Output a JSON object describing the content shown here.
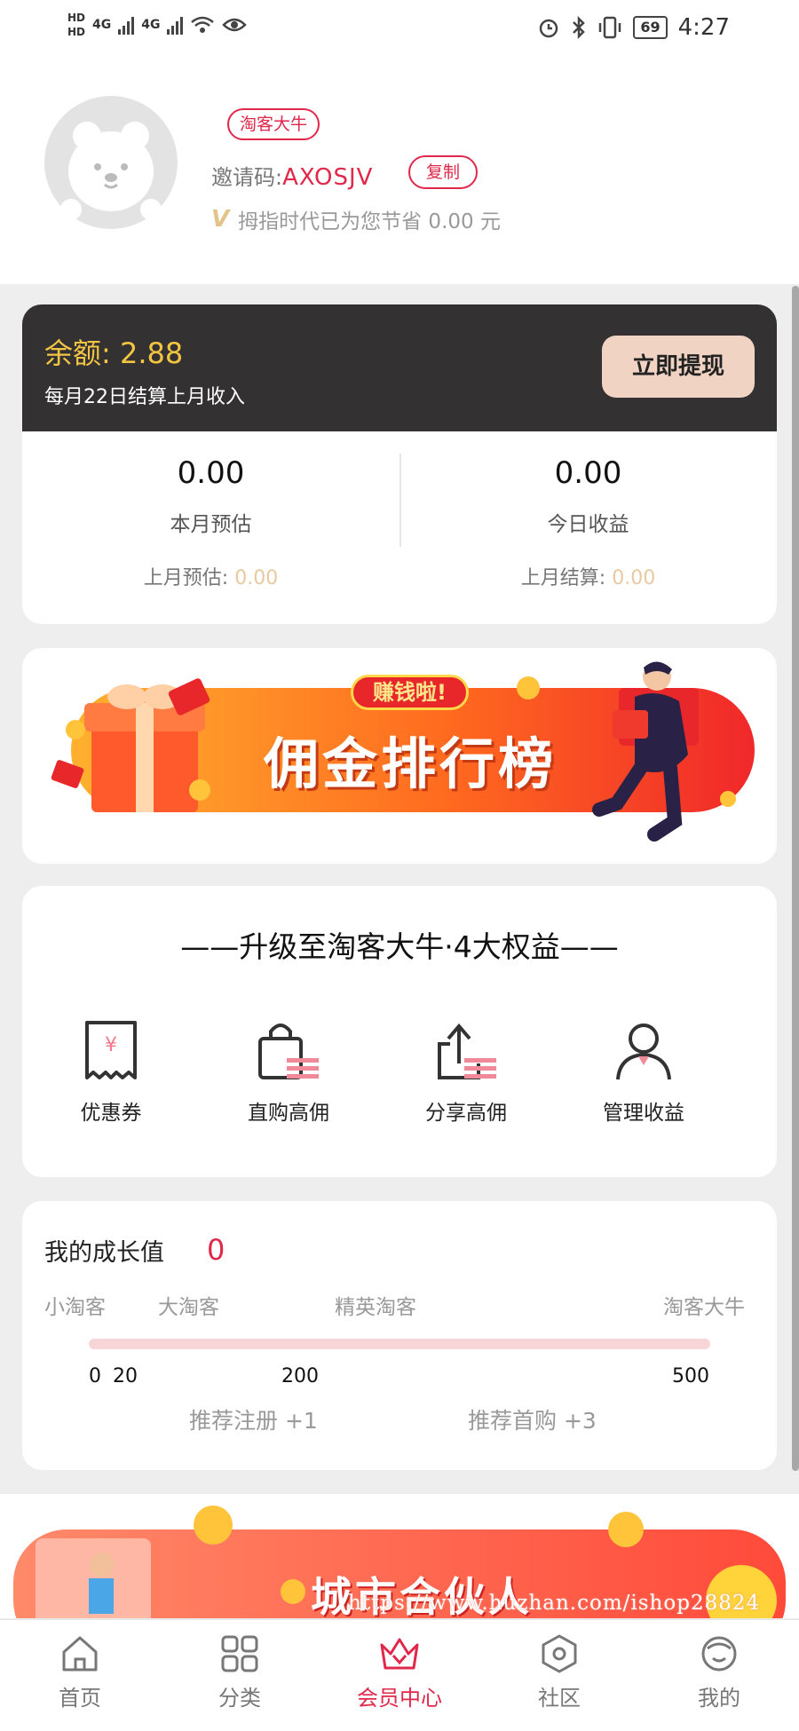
{
  "status_bar": {
    "network_left": "HD",
    "signal_1": "4G",
    "signal_2": "4G",
    "battery": "69",
    "time": "4:27"
  },
  "profile": {
    "level_badge": "淘客大牛",
    "invite_label": "邀请码:",
    "invite_code": "AXOSJV",
    "copy_label": "复制",
    "saved_text": "拇指时代已为您节省 0.00 元"
  },
  "balance": {
    "amount_label": "余额: 2.88",
    "settle_note": "每月22日结算上月收入",
    "withdraw_label": "立即提现",
    "month_estimate": "0.00",
    "month_estimate_label": "本月预估",
    "last_month_estimate_label": "上月预估:",
    "last_month_estimate": "0.00",
    "today_income": "0.00",
    "today_income_label": "今日收益",
    "last_month_settle_label": "上月结算:",
    "last_month_settle": "0.00"
  },
  "commission_banner": {
    "tag": "赚钱啦!",
    "title": "佣金排行榜"
  },
  "benefits": {
    "title": "——升级至淘客大牛·4大权益——",
    "items": [
      {
        "label": "优惠券",
        "icon": "coupon-icon"
      },
      {
        "label": "直购高佣",
        "icon": "shopping-bag-icon"
      },
      {
        "label": "分享高佣",
        "icon": "share-icon"
      },
      {
        "label": "管理收益",
        "icon": "user-manage-icon"
      }
    ]
  },
  "growth": {
    "title": "我的成长值",
    "value": "0",
    "levels": [
      "小淘客",
      "大淘客",
      "精英淘客",
      "淘客大牛"
    ],
    "ticks": [
      "0",
      "20",
      "200",
      "500"
    ],
    "progress": 0,
    "rule_register": "推荐注册 +1",
    "rule_first_purchase": "推荐首购 +3"
  },
  "partner_banner": {
    "title": "城市合伙人",
    "watermark": "https://www.huzhan.com/ishop28824"
  },
  "bottom_nav": [
    {
      "label": "首页",
      "icon": "home-icon"
    },
    {
      "label": "分类",
      "icon": "grid-icon"
    },
    {
      "label": "会员中心",
      "icon": "crown-icon",
      "active": true
    },
    {
      "label": "社区",
      "icon": "hexagon-icon"
    },
    {
      "label": "我的",
      "icon": "face-icon"
    }
  ],
  "colors": {
    "accent": "#e0284a",
    "balance_bg": "#333132",
    "balance_amount": "#f4c542",
    "withdraw_bg": "#f0d3c3",
    "muted_value": "#e8c9a0"
  }
}
